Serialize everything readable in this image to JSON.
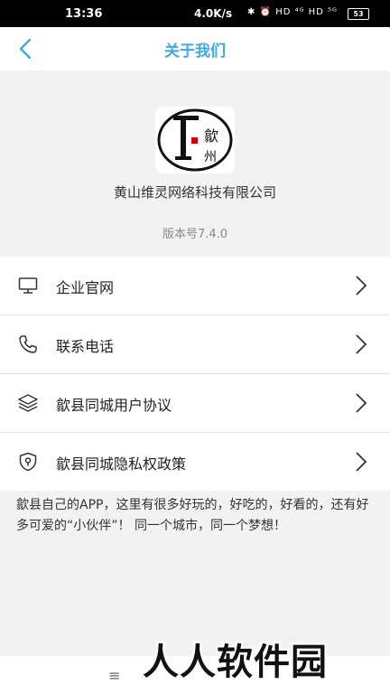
{
  "status_bar": {
    "time": "13:36",
    "speed": "4.0K/s",
    "icons": "✱ ⏰ HD ⁴ᴳ HD ⁵ᴳ",
    "battery": "53"
  },
  "header": {
    "back_icon": "chevron-left-icon",
    "title": "关于我们",
    "accent_color": "#3fa9e6"
  },
  "about": {
    "company_name": "黄山维灵网络科技有限公司",
    "version": "版本号7.4.0",
    "logo_text": "歙州"
  },
  "menu": {
    "items": [
      {
        "icon": "monitor-icon",
        "label": "企业官网"
      },
      {
        "icon": "phone-icon",
        "label": "联系电话"
      },
      {
        "icon": "layers-icon",
        "label": "歙县同城用户协议"
      },
      {
        "icon": "shield-icon",
        "label": "歙县同城隐私权政策"
      }
    ]
  },
  "description": "歙县自己的APP，这里有很多好玩的，好吃的，好看的，还有好多可爱的“小伙伴”！ 同一个城市，同一个梦想！",
  "bottom_bar": {
    "menu_icon": "≡",
    "watermark": "人人软件园"
  }
}
